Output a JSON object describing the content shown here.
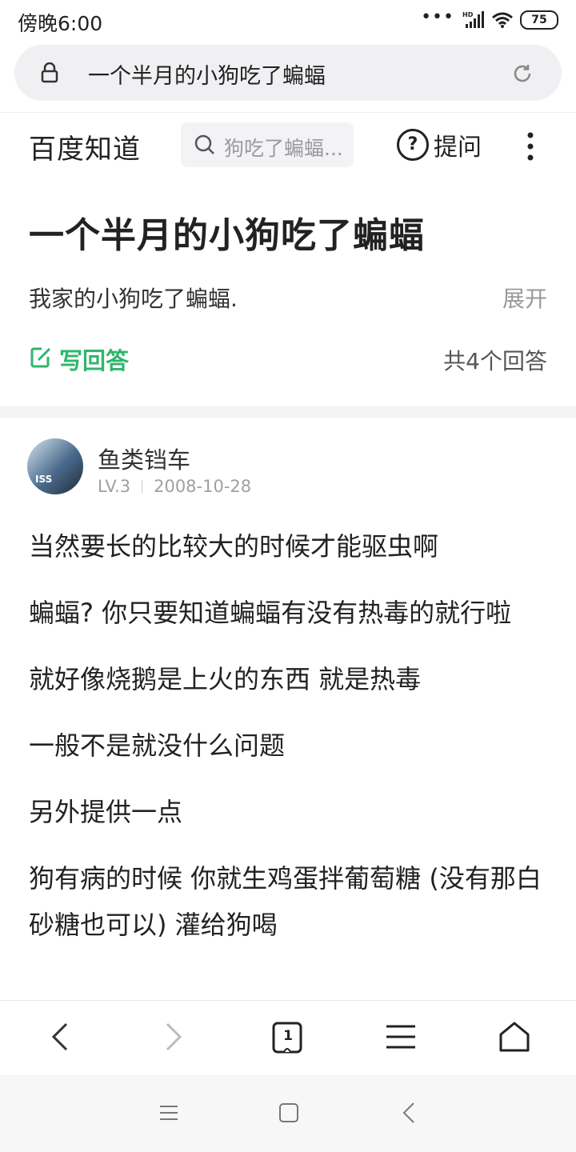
{
  "status": {
    "time": "傍晚6:00",
    "network_badge": "HD",
    "battery": "75"
  },
  "address_bar": {
    "url_text": "一个半月的小狗吃了蝙蝠"
  },
  "site_header": {
    "logo": "百度知道",
    "search_placeholder": "狗吃了蝙蝠...",
    "ask_label": "提问",
    "ask_icon_glyph": "?"
  },
  "question": {
    "title": "一个半月的小狗吃了蝙蝠",
    "body": "我家的小狗吃了蝙蝠.",
    "expand": "展开",
    "write_answer": "写回答",
    "answer_count": "共4个回答"
  },
  "answer": {
    "author": "鱼类铛车",
    "level": "LV.3",
    "date": "2008-10-28",
    "avatar_mark": "ISS",
    "paragraphs": [
      "当然要长的比较大的时候才能驱虫啊",
      "蝙蝠? 你只要知道蝙蝠有没有热毒的就行啦",
      "就好像烧鹅是上火的东西 就是热毒",
      "一般不是就没什么问题",
      "另外提供一点",
      "狗有病的时候 你就生鸡蛋拌葡萄糖 (没有那白砂糖也可以) 灌给狗喝"
    ]
  },
  "toolbar": {
    "tabs_count": "1"
  },
  "colors": {
    "accent_green": "#2fb66b",
    "text_dark": "#222222",
    "text_muted": "#9a9a9a"
  }
}
